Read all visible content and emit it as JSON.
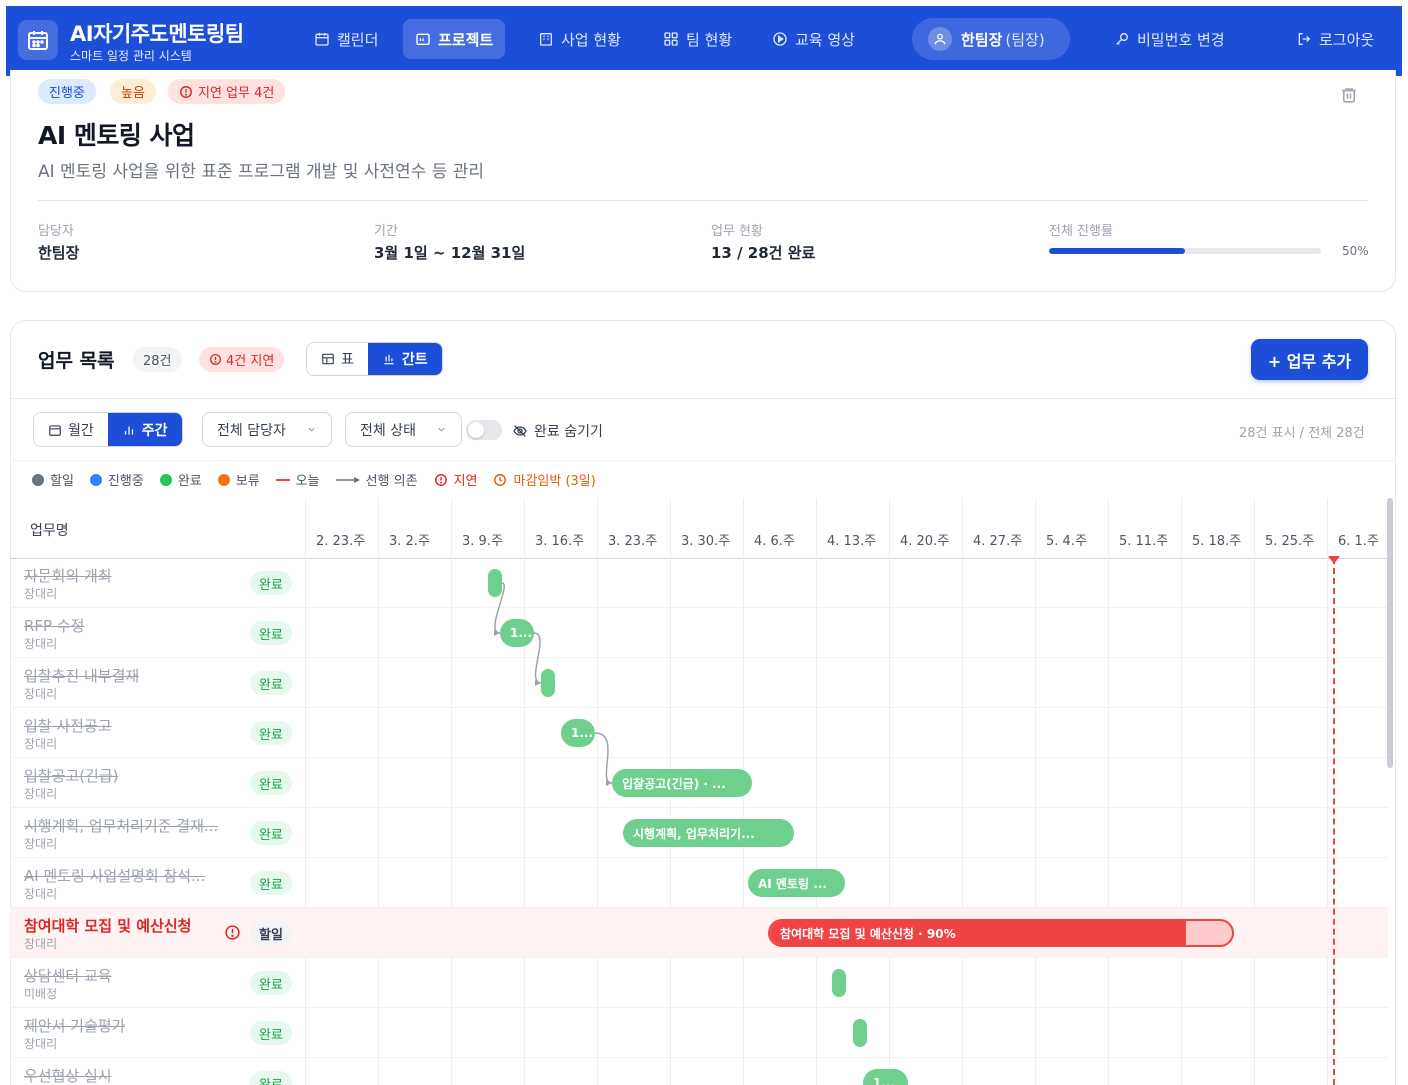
{
  "header": {
    "title": "AI자기주도멘토링팀",
    "subtitle": "스마트 일정 관리 시스템",
    "nav": [
      {
        "label": "캘린더",
        "icon": "calendar-icon"
      },
      {
        "label": "프로젝트",
        "icon": "folder-icon",
        "active": true
      },
      {
        "label": "사업 현황",
        "icon": "building-icon"
      },
      {
        "label": "팀 현황",
        "icon": "grid-icon"
      },
      {
        "label": "교육 영상",
        "icon": "play-icon"
      }
    ],
    "user": "한팀장",
    "user_role": "(팀장)",
    "change_password": "비밀번호 변경",
    "logout": "로그아웃"
  },
  "project": {
    "badges": {
      "status": "진행중",
      "priority": "높음",
      "delayed": "지연 업무 4건"
    },
    "title": "AI 멘토링 사업",
    "description": "AI 멘토링 사업을 위한 표준 프로그램 개발 및 사전연수 등 관리",
    "meta": {
      "owner_label": "담당자",
      "owner": "한팀장",
      "period_label": "기간",
      "period": "3월 1일 ~ 12월 31일",
      "tasks_label": "업무 현황",
      "tasks": "13 / 28건 완료",
      "progress_label": "전체 진행률",
      "progress": 50,
      "progress_text": "50%"
    }
  },
  "tasks_panel": {
    "title": "업무 목록",
    "count": "28건",
    "delayed": "4건 지연",
    "view_table": "표",
    "view_gantt": "간트",
    "add_button": "+ 업무 추가",
    "scale_month": "월간",
    "scale_week": "주간",
    "filter_owner": "전체 담당자",
    "filter_status": "전체 상태",
    "hide_done": "완료 숨기기",
    "count_text": "28건 표시 / 전체 28건",
    "legend": {
      "todo": "할일",
      "in_progress": "진행중",
      "done": "완료",
      "hold": "보류",
      "today": "오늘",
      "dependency": "선행 의존",
      "delayed": "지연",
      "due_soon": "마감임박 (3일)"
    }
  },
  "gantt": {
    "name_column": "업무명",
    "weeks": [
      "2. 23.주",
      "3. 2.주",
      "3. 9.주",
      "3. 16.주",
      "3. 23.주",
      "3. 30.주",
      "4. 6.주",
      "4. 13.주",
      "4. 20.주",
      "4. 27.주",
      "5. 4.주",
      "5. 11.주",
      "5. 18.주",
      "5. 25.주",
      "6. 1.주"
    ],
    "rows": [
      {
        "name": "자문회의 개최",
        "owner": "장대리",
        "status": "완료",
        "bar_label": ""
      },
      {
        "name": "RFP 수정",
        "owner": "장대리",
        "status": "완료",
        "bar_label": "1..."
      },
      {
        "name": "입찰추진 내부결재",
        "owner": "장대리",
        "status": "완료",
        "bar_label": ""
      },
      {
        "name": "입찰 사전공고",
        "owner": "장대리",
        "status": "완료",
        "bar_label": "1..."
      },
      {
        "name": "입찰공고(긴급)",
        "owner": "장대리",
        "status": "완료",
        "bar_label": "입찰공고(긴급) · ..."
      },
      {
        "name": "시행계획, 업무처리기준 결재...",
        "owner": "장대리",
        "status": "완료",
        "bar_label": "시행계획, 업무처리기..."
      },
      {
        "name": "AI 멘토링 사업설명회 참석...",
        "owner": "장대리",
        "status": "완료",
        "bar_label": "AI 멘토링 ..."
      },
      {
        "name": "참여대학 모집 및 예산신청",
        "owner": "장대리",
        "status": "할일",
        "bar_label": "참여대학 모집 및 예산신청 · 90%",
        "progress": 90
      },
      {
        "name": "상담센터 교육",
        "owner": "미배정",
        "status": "완료",
        "bar_label": ""
      },
      {
        "name": "제안서 기술평가",
        "owner": "장대리",
        "status": "완료",
        "bar_label": ""
      },
      {
        "name": "우선협상 실시",
        "owner": "",
        "status": "완료",
        "bar_label": "1..."
      }
    ]
  },
  "colors": {
    "primary": "#1d4ed8",
    "done": "#6fd08e",
    "delay": "#ef4444",
    "todo": "#6b7280",
    "hold": "#f97316"
  }
}
